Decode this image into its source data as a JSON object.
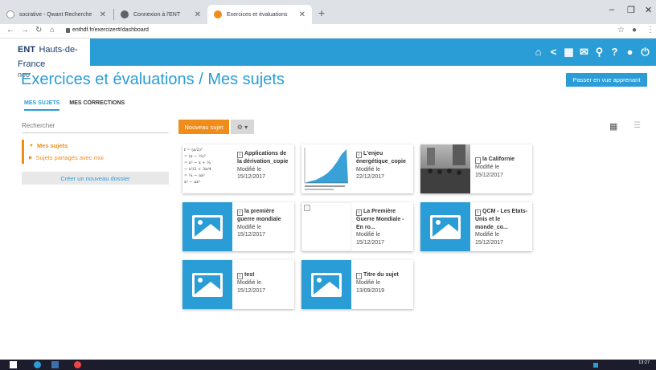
{
  "browser": {
    "tabs": [
      {
        "title": "socrative - Qwant Recherche",
        "active": false,
        "favicon_color": "#ffffff"
      },
      {
        "title": "Connexion à l'ENT",
        "active": false,
        "favicon_color": "#5f6368"
      },
      {
        "title": "Exercices et évaluations",
        "active": true,
        "favicon_color": "#f08c1a"
      }
    ],
    "new_tab": "+",
    "url": "enthdf.fr/exercizer#/dashboard",
    "window": {
      "minimize": "–",
      "maximize": "❐",
      "close": "✕"
    }
  },
  "app": {
    "logo": {
      "ent": "ENT",
      "region": "Hauts-de-France",
      "neo": "neo"
    },
    "icons": [
      "home-icon",
      "share-icon",
      "apps-icon",
      "mail-icon",
      "search-icon",
      "help-icon",
      "user-icon",
      "logout-icon"
    ],
    "accent": "#2a9cd6",
    "orange": "#f08c1a"
  },
  "page": {
    "title": "Exercices et évaluations / Mes sujets",
    "learner_button": "Passer en vue apprenant",
    "tabs": [
      {
        "label": "MES SUJETS",
        "active": true
      },
      {
        "label": "MES CORRECTIONS",
        "active": false
      }
    ],
    "search_placeholder": "Rechercher",
    "folders": [
      {
        "label": "Mes sujets",
        "selected": true,
        "icon": "▼"
      },
      {
        "label": "Sujets partagés avec moi",
        "selected": false,
        "icon": "▶"
      }
    ],
    "new_folder_button": "Créer un nouveau dossier",
    "new_subject_button": "Nouveau sujet",
    "gear_button": "⚙ ▾"
  },
  "cards": [
    {
      "title": "Applications de la dérivation_copie",
      "modified_label": "Modifié le",
      "date": "15/12/2017",
      "thumb": "formula",
      "type": "list"
    },
    {
      "title": "L'enjeu énergétique_copie",
      "modified_label": "Modifié le",
      "date": "22/12/2017",
      "thumb": "chart",
      "type": "list"
    },
    {
      "title": "la Californie",
      "modified_label": "Modifié le",
      "date": "15/12/2017",
      "thumb": "photo",
      "type": "doc"
    },
    {
      "title": "la première guerre mondiale",
      "modified_label": "Modifié le",
      "date": "15/12/2017",
      "thumb": "placeholder",
      "type": "list"
    },
    {
      "title": "La Première Guerre Mondiale - En ro...",
      "modified_label": "Modifié le",
      "date": "15/12/2017",
      "thumb": "broken",
      "type": "list"
    },
    {
      "title": "QCM - Les Etats-Unis et le monde_co...",
      "modified_label": "Modifié le",
      "date": "15/12/2017",
      "thumb": "placeholder",
      "type": "list"
    },
    {
      "title": "test",
      "modified_label": "Modifié le",
      "date": "15/12/2017",
      "thumb": "placeholder",
      "type": "list"
    },
    {
      "title": "Titre du sujet",
      "modified_label": "Modifié le",
      "date": "13/09/2019",
      "thumb": "placeholder",
      "type": "doc"
    }
  ],
  "taskbar": {
    "time": "13:27"
  }
}
